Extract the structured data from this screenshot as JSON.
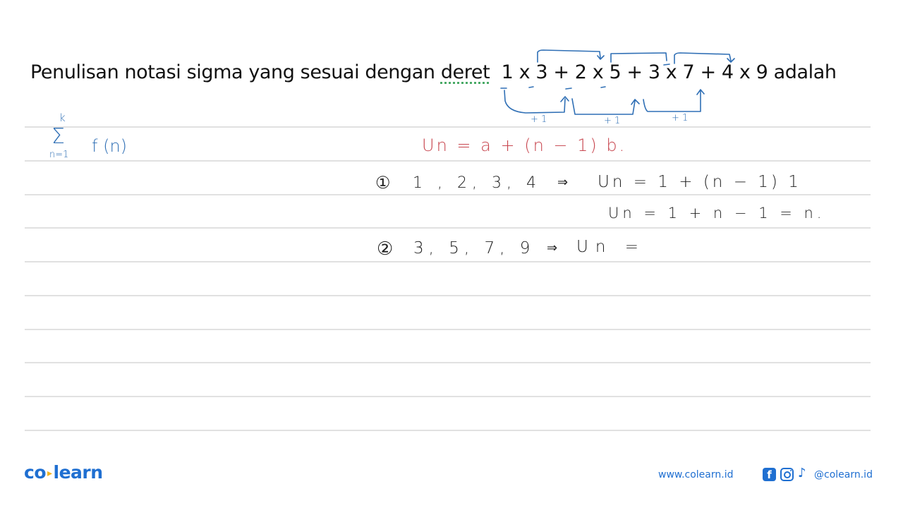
{
  "question": {
    "prefix": "Penulisan notasi sigma yang sesuai dengan ",
    "deret_word": "deret",
    "series": "1 x 3 + 2 x 5 + 3 x 7 + 4 x 9",
    "suffix": "adalah"
  },
  "annotations": {
    "plus_one_labels": [
      "+ 1",
      "+ 1",
      "+ 1"
    ]
  },
  "handwriting": {
    "sigma_upper": "k",
    "sigma_symbol": "Σ",
    "sigma_lower": "n=1",
    "sigma_function": "f (n)",
    "formula": "Un = a + (n − 1) b.",
    "step1_marker": "①",
    "step1_sequence": "1 , 2, 3, 4",
    "step1_arrow": "⇒",
    "step1_result": "Un = 1 + (n − 1) 1",
    "step1_simplified": "Un = 1 + n − 1 = n.",
    "step2_marker": "②",
    "step2_sequence": "3, 5, 7, 9",
    "step2_arrow": "⇒",
    "step2_result": "Un ="
  },
  "footer": {
    "logo_left": "co",
    "logo_dot": "▸",
    "logo_right": "learn",
    "website": "www.colearn.id",
    "facebook_glyph": "f",
    "tiktok_glyph": "♪",
    "social_handle": "@colearn.id"
  },
  "colors": {
    "annotation_blue": "#2f6fb5",
    "formula_red": "#c8464f",
    "brand_blue": "#1f6fd1",
    "brand_yellow": "#f3b421"
  }
}
